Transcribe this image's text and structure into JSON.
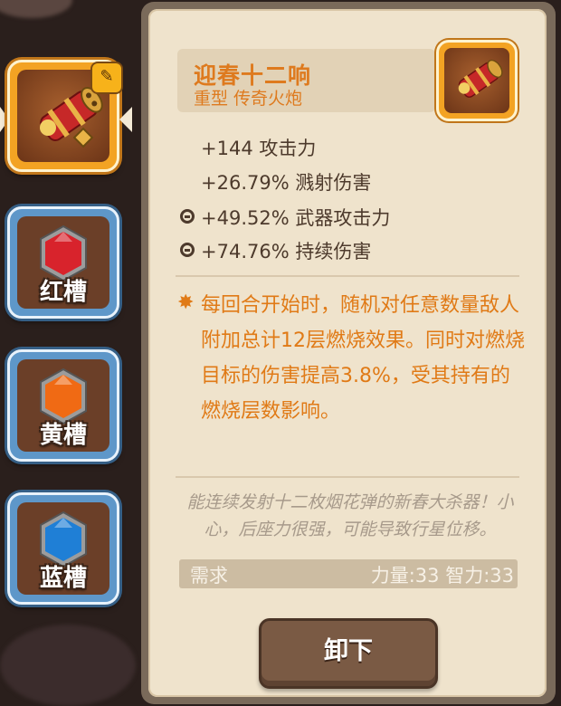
{
  "slots": {
    "weapon": {
      "icon": "firework-cannon-icon",
      "badge_icon": "wrench-icon"
    },
    "gems": [
      {
        "label": "红槽",
        "icon": "red-gem-icon",
        "color": "#d8232c"
      },
      {
        "label": "黄槽",
        "icon": "orange-gem-icon",
        "color": "#f06a14"
      },
      {
        "label": "蓝槽",
        "icon": "blue-gem-icon",
        "color": "#1f7fd6"
      }
    ]
  },
  "item": {
    "name": "迎春十二响",
    "type": "重型 传奇火炮",
    "icon": "firework-cannon-icon",
    "stats": [
      {
        "text": "+144 攻击力",
        "locked": false
      },
      {
        "text": "+26.79% 溅射伤害",
        "locked": false
      },
      {
        "text": "+49.52% 武器攻击力",
        "locked": true
      },
      {
        "text": "+74.76% 持续伤害",
        "locked": true
      }
    ],
    "effect_icon": "star-icon",
    "effect": "每回合开始时，随机对任意数量敌人附加总计12层燃烧效果。同时对燃烧目标的伤害提高3.8%，受其持有的燃烧层数影响。",
    "flavor": "能连续发射十二枚烟花弹的新春大杀器！小心，后座力很强，可能导致行星位移。",
    "requirement_label": "需求",
    "requirement_value": "力量:33 智力:33"
  },
  "actions": {
    "unequip_label": "卸下"
  },
  "colors": {
    "accent_orange": "#de7a1e",
    "text_brown": "#4d3a2c",
    "panel_bg": "#efe3cc"
  }
}
